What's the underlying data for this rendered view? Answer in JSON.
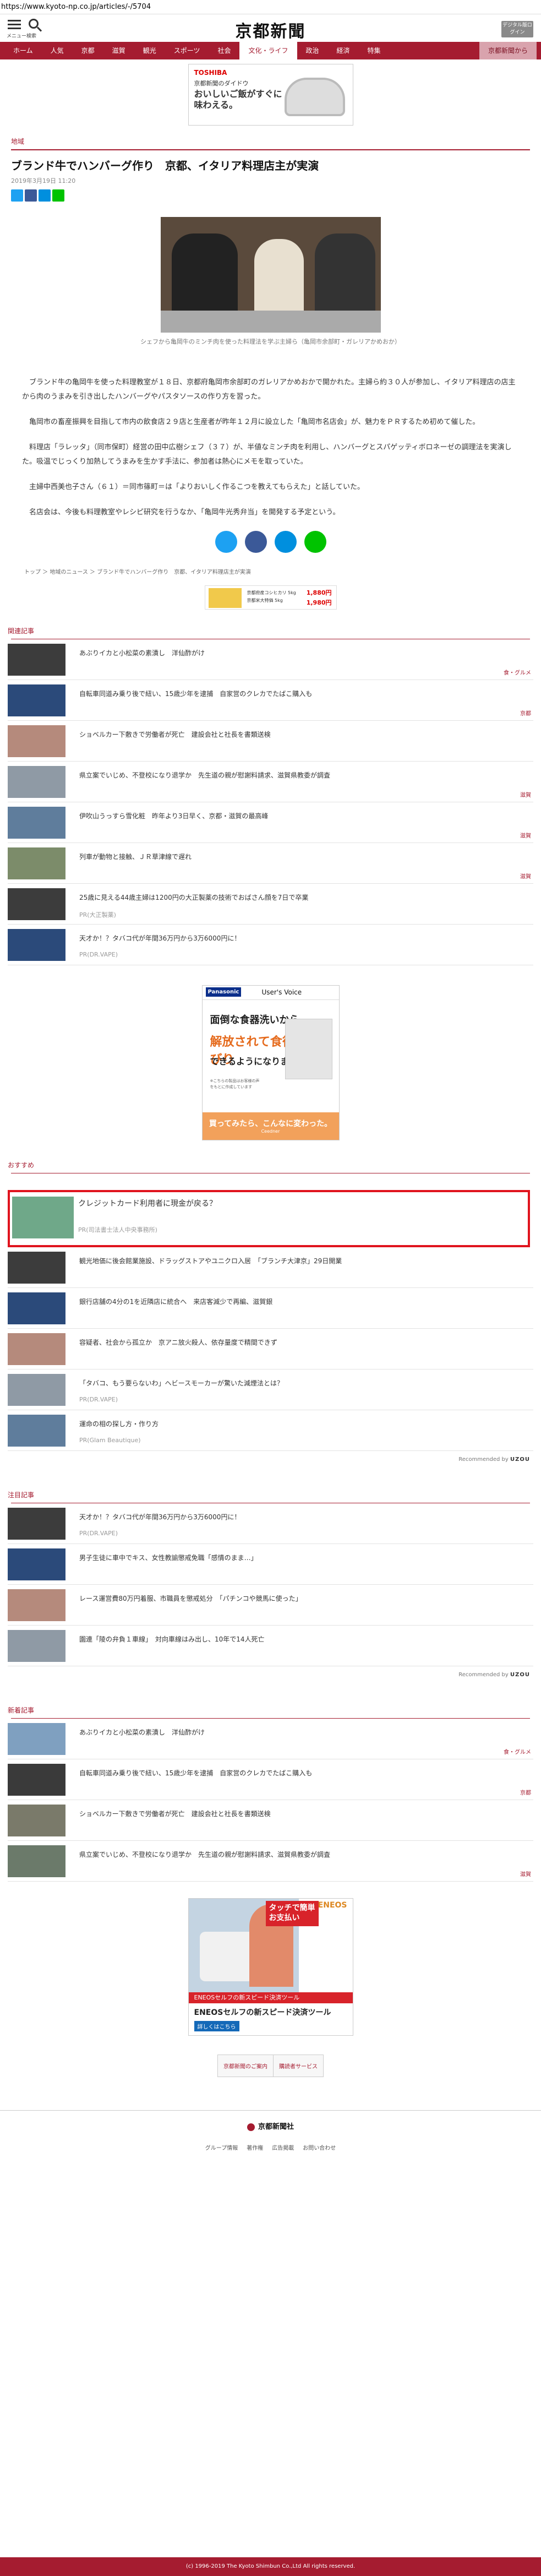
{
  "browser": {
    "url": "https://www.kyoto-np.co.jp/articles/-/5704"
  },
  "header": {
    "menu_label": "メニュー",
    "search_label": "検索",
    "logo": "京都新聞",
    "login_label": "デジタル版ログイン"
  },
  "nav": {
    "items": [
      "ホーム",
      "人気",
      "京都",
      "滋賀",
      "観光",
      "スポーツ",
      "社会",
      "文化・ライフ",
      "政治",
      "経済",
      "特集",
      "京都新聞から"
    ],
    "active_index": 7
  },
  "ad_top": {
    "brand": "TOSHIBA",
    "line1": "京都新聞のダイドウ",
    "line2": "おいしいご飯がすぐに味わえる。"
  },
  "article": {
    "section": "地域",
    "title": "ブランド牛でハンバーグ作り　京都、イタリア料理店主が実演",
    "date": "2019年3月19日 11:20",
    "photo_caption": "シェフから亀岡牛のミンチ肉を使った料理法を学ぶ主婦ら（亀岡市余部町・ガレリアかめおか）",
    "paragraphs": [
      "ブランド牛の亀岡牛を使った料理教室が１８日、京都府亀岡市余部町のガレリアかめおかで開かれた。主婦ら約３０人が参加し、イタリア料理店の店主から肉のうまみを引き出したハンバーグやパスタソースの作り方を習った。",
      "亀岡市の畜産振興を目指して市内の飲食店２９店と生産者が昨年１２月に設立した「亀岡市名店会」が、魅力をＰＲするため初めて催した。",
      "料理店「ラレッタ」（同市保町）経営の田中広樹シェフ（３７）が、半値なミンチ肉を利用し、ハンバーグとスパゲッティボロネーゼの調理法を実演した。吸温でじっくり加熱してうまみを生かす手法に、参加者は熱心にメモを取っていた。",
      "主婦中西美也子さん（６１）＝同市篠町＝は「よりおいしく作るこつを教えてもらえた」と話していた。",
      "名店会は、今後も料理教室やレシピ研究を行うなか、「亀岡牛光秀弁当」を開発する予定という。"
    ],
    "breadcrumb": "トップ ＞ 地域のニュース ＞ ブランド牛でハンバーグ作り　京都、イタリア料理店主が実演"
  },
  "ad_mid": {
    "line1": "京都府産コシヒカリ 5kg",
    "line2": "京都米大特価 5kg",
    "price1": "1,880円",
    "price2": "1,980円"
  },
  "related": {
    "title": "関連記事",
    "items": [
      {
        "title": "あぶりイカと小松菜の素漬し　洋仙酢がけ",
        "cat": "食・グルメ",
        "sub": ""
      },
      {
        "title": "自転車同道み乗り後で紐い、15歳少年を逮捕　自家営のクレカでたばこ購入も",
        "cat": "京都",
        "sub": ""
      },
      {
        "title": "ショベルカー下敷きで労働者が死亡　建設会社と社長を書類送検",
        "cat": "",
        "sub": ""
      },
      {
        "title": "県立案でいじめ、不登校になり退学か　先生道の親が慰謝料請求、滋賀県教委が調査",
        "cat": "滋賀",
        "sub": ""
      },
      {
        "title": "伊吹山うっすら雪化粧　昨年より3日早く、京都・滋賀の最高峰",
        "cat": "滋賀",
        "sub": ""
      },
      {
        "title": "列車が動物と接触、ＪＲ草津線で遅れ",
        "cat": "滋賀",
        "sub": ""
      },
      {
        "title": "25歳に見える44歳主婦は1200円の大正製薬の技術でおばさん顔を7日で卒業",
        "cat": "",
        "sub": "PR(大正製薬)"
      },
      {
        "title": "天才か！？タバコ代が年間36万円から3万6000円に！",
        "cat": "",
        "sub": "PR(DR.VAPE)"
      }
    ]
  },
  "ad_square": {
    "brand": "Panasonic",
    "title": "User's Voice",
    "line1": "面倒な食器洗いから",
    "line2": "解放されて食後にのんびり",
    "line3": "できるようになりました。",
    "note": "※こちらの製品はお客様の声をもとに作成しています",
    "footer": "買ってみたら、こんなに変わった。",
    "footer_small": "Ceedner"
  },
  "osusume": {
    "title": "おすすめ",
    "highlight": {
      "title": "クレジットカード利用者に現金が戻る？",
      "sub": "PR(司法書士法人中央事務所)"
    },
    "items": [
      {
        "title": "観光地価に後会館業施設、ドラッグストアやユニクロ入居　「ブランチ大津京」29日開業",
        "sub": ""
      },
      {
        "title": "銀行店舗の4分の1を近隣店に統合へ　来店客減少で再編、滋賀銀",
        "sub": ""
      },
      {
        "title": "容疑者、社会から孤立か　京アニ放火殺人、依存量度で精間できず",
        "sub": ""
      },
      {
        "title": "「タバコ、もう要らないわ」ヘビースモーカーが驚いた減煙法とは？",
        "sub": "PR(DR.VAPE)"
      },
      {
        "title": "運命の相の探し方・作り方",
        "sub": "PR(Glam Beautique)"
      }
    ],
    "recommended_by": "Recommended by",
    "provider": "UZOU"
  },
  "chumoku": {
    "title": "注目記事",
    "items": [
      {
        "title": "天才か！？タバコ代が年間36万円から3万6000円に！",
        "sub": "PR(DR.VAPE)"
      },
      {
        "title": "男子生徒に車中でキス、女性教諭懲戒免職「感情のまま…」",
        "sub": ""
      },
      {
        "title": "レース運営費80万円着服、市職員を懲戒処分　「パチンコや競馬に使った」",
        "sub": ""
      },
      {
        "title": "園連「陵の弁負１車線」　対向車線はみ出し、10年で14人死亡",
        "sub": ""
      }
    ],
    "recommended_by": "Recommended by",
    "provider": "UZOU"
  },
  "shinchaku": {
    "title": "新着記事",
    "items": [
      {
        "title": "あぶりイカと小松菜の素漬し　洋仙酢がけ",
        "cat": "食・グルメ"
      },
      {
        "title": "自転車同道み乗り後で紐い、15歳少年を逮捕　自家営のクレカでたばこ購入も",
        "cat": "京都"
      },
      {
        "title": "ショベルカー下敷きで労働者が死亡　建設会社と社長を書類送検",
        "cat": ""
      },
      {
        "title": "県立案でいじめ、不登校になり退学か　先生道の親が慰謝料請求、滋賀県教委が調査",
        "cat": "滋賀"
      }
    ]
  },
  "ad_bottom": {
    "tag": "タッチで簡単お支払い",
    "brand": "ENEOS",
    "banner": "ENEOSセルフの新スピード決済ツール",
    "big": "ENEOSセルフの新スピード決済ツール",
    "more": "詳しくはこちら"
  },
  "footer": {
    "links": [
      "京都新聞のご案内",
      "購読者サービス"
    ],
    "logo": "京都新聞社",
    "nav": [
      "グループ情報",
      "著作権",
      "広告掲載",
      "お問い合わせ"
    ],
    "copyright": "(c) 1996-2019 The Kyoto Shimbun Co.,Ltd All rights reserved."
  },
  "colors": {
    "brand": "#a51c30",
    "twitter": "#1da1f2",
    "facebook": "#3b5998",
    "hatena": "#008fde",
    "line": "#00c300",
    "highlight": "#e0141e"
  }
}
